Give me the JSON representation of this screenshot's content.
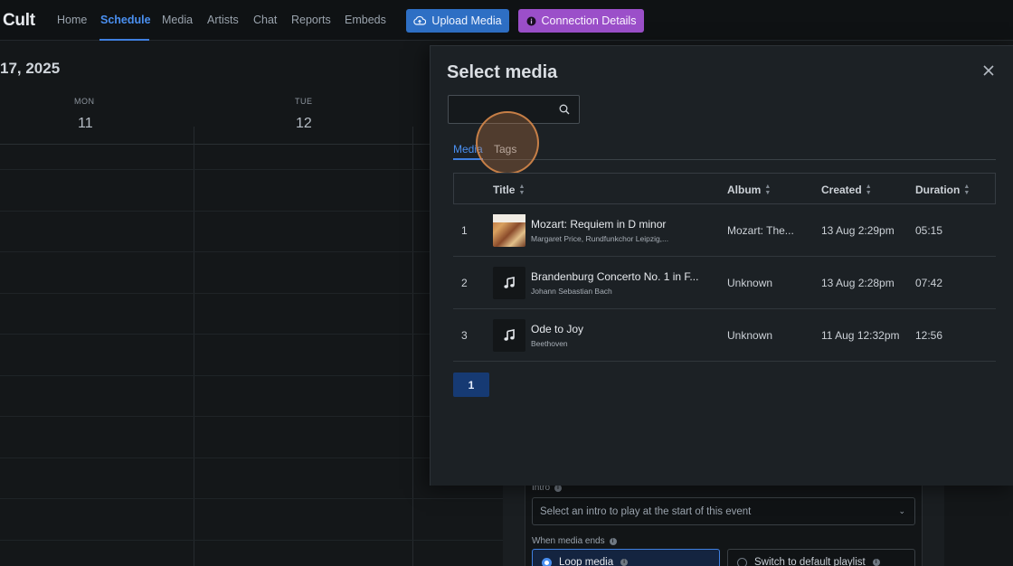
{
  "nav": {
    "brand": "Cult",
    "links": [
      "Home",
      "Schedule",
      "Media",
      "Artists",
      "Chat",
      "Reports",
      "Embeds"
    ],
    "upload_label": "Upload Media",
    "connection_label": "Connection Details"
  },
  "calendar": {
    "date_title": "17, 2025",
    "days": [
      {
        "dow": "MON",
        "num": "11"
      },
      {
        "dow": "TUE",
        "num": "12"
      }
    ]
  },
  "form": {
    "intro_label": "Intro",
    "intro_placeholder": "Select an intro to play at the start of this event",
    "media_ends_label": "When media ends",
    "loop_label": "Loop media",
    "switch_label": "Switch to default playlist"
  },
  "modal": {
    "title": "Select media",
    "search_value": "",
    "tabs": [
      "Media",
      "Tags"
    ],
    "columns": {
      "title": "Title",
      "album": "Album",
      "created": "Created",
      "duration": "Duration"
    },
    "rows": [
      {
        "index": "1",
        "title": "Mozart: Requiem in D minor",
        "artist": "Margaret Price, Rundfunkchor Leipzig,...",
        "album": "Mozart: The...",
        "created": "13 Aug 2:29pm",
        "duration": "05:15"
      },
      {
        "index": "2",
        "title": "Brandenburg Concerto No. 1 in F...",
        "artist": "Johann Sebastian Bach",
        "album": "Unknown",
        "created": "13 Aug 2:28pm",
        "duration": "07:42"
      },
      {
        "index": "3",
        "title": "Ode to Joy",
        "artist": "Beethoven",
        "album": "Unknown",
        "created": "11 Aug 12:32pm",
        "duration": "12:56"
      }
    ],
    "page": "1"
  },
  "colors": {
    "accent": "#3f7fe0",
    "upload_button": "#2e6fc4",
    "connection_button": "#9b4fc9",
    "modal_bg": "#1c2125"
  },
  "icons": {
    "upload": "cloud-upload-icon",
    "connection": "info-icon",
    "search": "search-icon",
    "close": "close-icon",
    "track": "music-note-icon"
  }
}
